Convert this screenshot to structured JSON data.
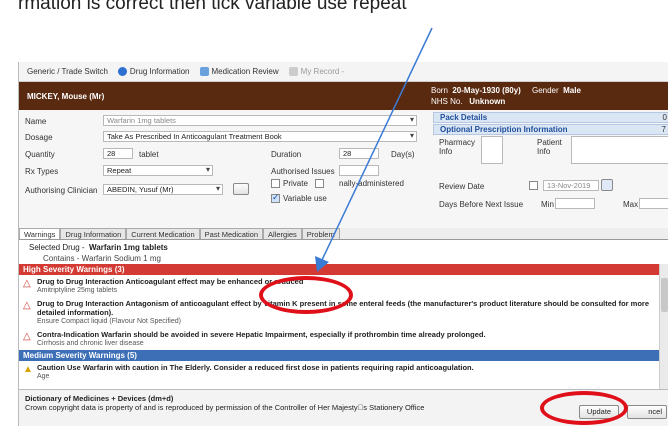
{
  "caption": "rmation is correct then tick variable use repeat",
  "toolbar": {
    "items": [
      "Generic / Trade Switch",
      "Drug Information",
      "Medication Review",
      "My Record -"
    ]
  },
  "patient": {
    "name": "MICKEY, Mouse (Mr)",
    "born_label": "Born",
    "born_value": "20-May-1930 (80y)",
    "gender_label": "Gender",
    "gender_value": "Male",
    "nhs_label": "NHS No.",
    "nhs_value": "Unknown"
  },
  "form": {
    "name_label": "Name",
    "name_value": "Warfarin 1mg tablets",
    "dosage_label": "Dosage",
    "dosage_value": "Take As Prescribed In Anticoagulant Treatment Book",
    "quantity_label": "Quantity",
    "quantity_value": "28",
    "quantity_unit": "tablet",
    "duration_label": "Duration",
    "duration_value": "28",
    "duration_unit": "Day(s)",
    "rxtype_label": "Rx Types",
    "rxtype_value": "Repeat",
    "authorised_issues_label": "Authorised Issues",
    "private_label": "Private",
    "personally_admin_label": "nally-administered",
    "variable_use_label": "Variable use",
    "clinician_label": "Authorising Clinician",
    "clinician_value": "ABEDIN, Yusuf (Mr)"
  },
  "panel": {
    "pack_details": "Pack Details",
    "optional_info": "Optional Prescription Information",
    "pharmacy_info": "Pharmacy Info",
    "patient_info": "Patient Info",
    "review_date_label": "Review Date",
    "review_date_value": "13-Nov-2019",
    "days_before_label": "Days Before Next Issue",
    "min_label": "Min",
    "max_label": "Max",
    "edge_mark_1": "0",
    "edge_mark_2": "7"
  },
  "tabs": [
    "Warnings",
    "Drug Information",
    "Current Medication",
    "Past Medication",
    "Allergies",
    "Problem"
  ],
  "selected_drug": {
    "label": "Selected Drug -",
    "value": "Warfarin 1mg tablets",
    "contains": "Contains - Warfarin Sodium 1 mg"
  },
  "warnings": {
    "high_header": "High Severity Warnings (3)",
    "high_items": [
      {
        "title": "Drug to Drug Interaction  Anticoagulant effect may be enhanced or reduced",
        "sub": "Amitriptyline 25mg tablets"
      },
      {
        "title": "Drug to Drug Interaction  Antagonism of anticoagulant effect by vitamin K present in some enteral feeds (the manufacturer's product literature should be consulted for more detailed information).",
        "sub": "Ensure Compact liquid (Flavour Not Specified)"
      },
      {
        "title": "Contra-Indication  Warfarin should be avoided in severe Hepatic Impairment, especially if prothrombin time already prolonged.",
        "sub": "Cirrhosis and chronic liver disease"
      }
    ],
    "medium_header": "Medium Severity Warnings (5)",
    "medium_items": [
      {
        "title": "Caution  Use Warfarin with caution in The Elderly. Consider a reduced first dose in patients requiring rapid anticoagulation.",
        "sub": "Age"
      }
    ]
  },
  "footer": {
    "line1": "Dictionary of Medicines + Devices (dm+d)",
    "line2": "Crown copyright data is property of and is reproduced by permission of the Controller of Her Majesty\u0000s Stationery Office",
    "update_label": "Update",
    "cancel_label": "ncel"
  },
  "colors": {
    "header_bg": "#5a2a10",
    "high_severity": "#d23a33",
    "medium_severity": "#3d6fb6",
    "annotation": "#e0101a",
    "arrow": "#3a7bd5"
  }
}
